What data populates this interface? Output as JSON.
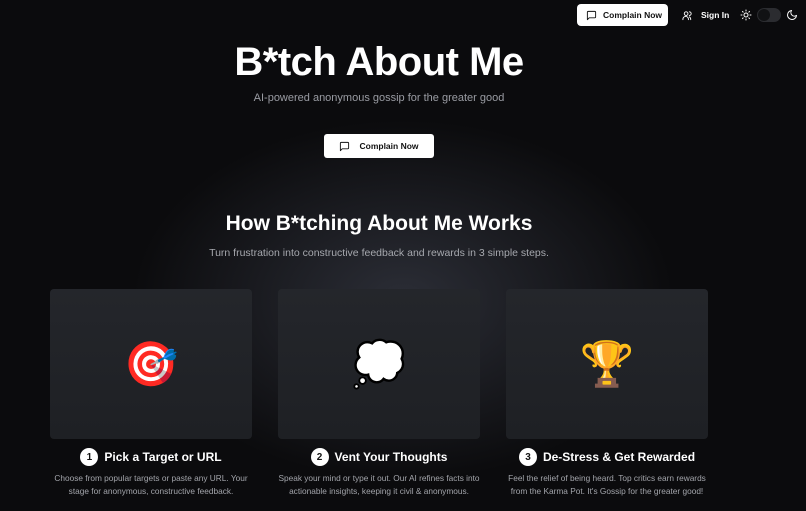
{
  "nav": {
    "complain_label": "Complain Now",
    "signin_label": "Sign In",
    "theme_icons": [
      "sun-icon",
      "moon-icon"
    ],
    "theme_toggle": "off"
  },
  "hero": {
    "title": "B*tch About Me",
    "subtitle": "AI-powered anonymous gossip for the greater good",
    "cta_label": "Complain Now"
  },
  "how": {
    "title": "How B*tching About Me Works",
    "subtitle": "Turn frustration into constructive feedback and rewards in 3 simple steps.",
    "steps": [
      {
        "number": "1",
        "emoji": "🎯",
        "title": "Pick a Target or URL",
        "description": "Choose from popular targets or paste any URL. Your stage for anonymous, constructive feedback."
      },
      {
        "number": "2",
        "emoji": "💭",
        "title": "Vent Your Thoughts",
        "description": "Speak your mind or type it out. Our AI refines facts into actionable insights, keeping it civil & anonymous."
      },
      {
        "number": "3",
        "emoji": "🏆",
        "title": "De-Stress & Get Rewarded",
        "description": "Feel the relief of being heard. Top critics earn rewards from the Karma Pot. It's Gossip for the greater good!"
      }
    ]
  },
  "colors": {
    "background": "#0b0b0d",
    "card": "#24262b",
    "button_bg": "#ffffff",
    "muted_text": "#9a9ca3"
  }
}
